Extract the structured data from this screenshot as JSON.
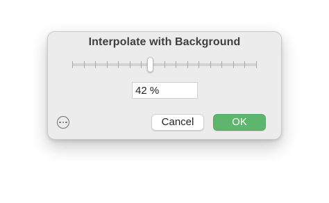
{
  "dialog": {
    "title": "Interpolate with Background",
    "slider": {
      "value_fraction": 0.42,
      "tick_count": 17
    },
    "value_field": {
      "value": "42 %"
    },
    "more_button": {
      "icon": "ellipsis-circle-icon"
    },
    "buttons": {
      "cancel_label": "Cancel",
      "ok_label": "OK"
    },
    "colors": {
      "ok_button": "#5db56e",
      "dialog_background": "#ececec"
    }
  }
}
